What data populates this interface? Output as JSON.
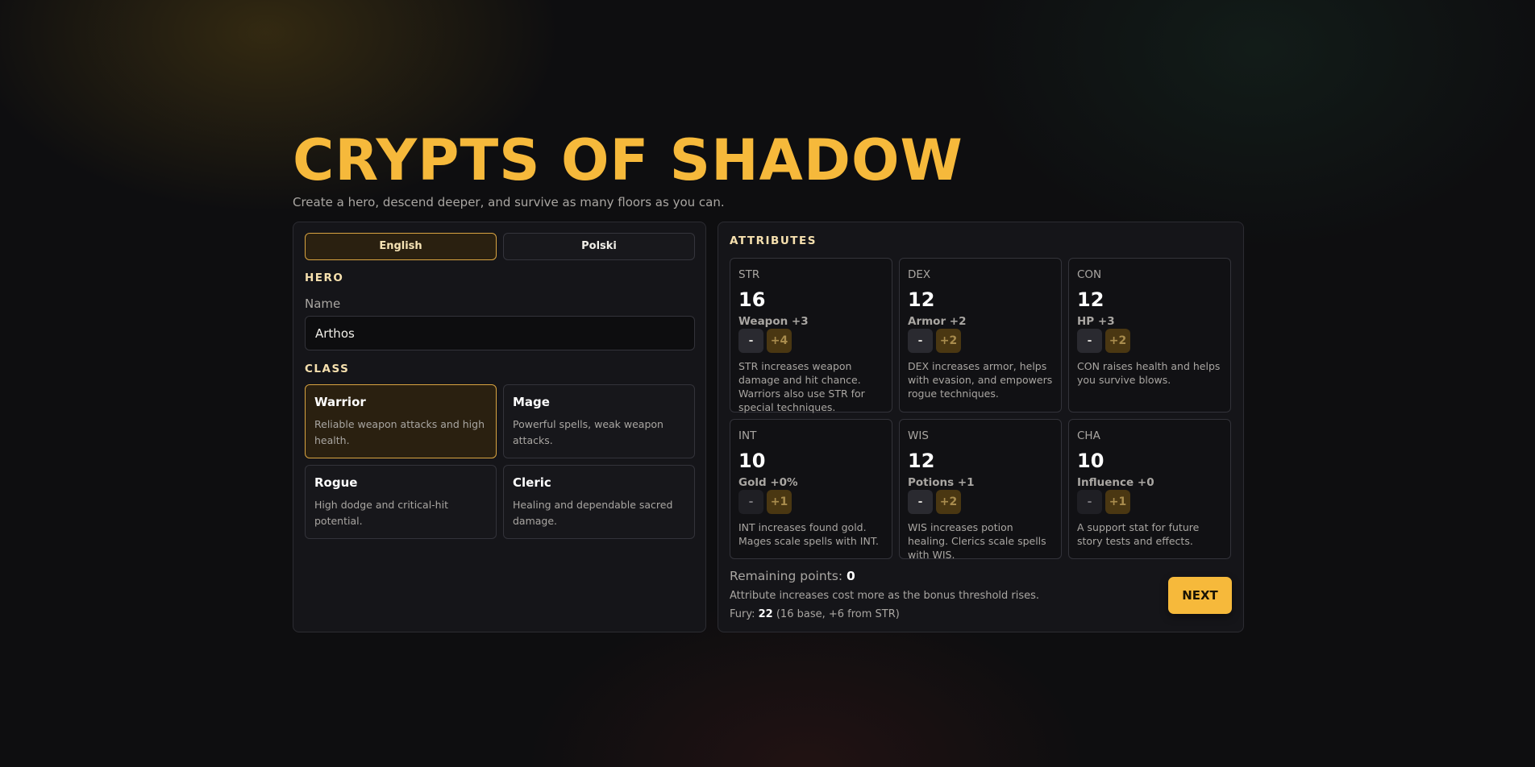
{
  "header": {
    "title": "CRYPTS OF SHADOW",
    "subtitle": "Create a hero, descend deeper, and survive as many floors as you can."
  },
  "languages": {
    "english": "English",
    "polski": "Polski",
    "active": "English"
  },
  "hero": {
    "section_label": "HERO",
    "name_label": "Name",
    "name_value": "Arthos"
  },
  "class_section": {
    "label": "CLASS",
    "selected": "Warrior",
    "classes": [
      {
        "name": "Warrior",
        "desc": "Reliable weapon attacks and high health."
      },
      {
        "name": "Mage",
        "desc": "Powerful spells, weak weapon attacks."
      },
      {
        "name": "Rogue",
        "desc": "High dodge and critical-hit potential."
      },
      {
        "name": "Cleric",
        "desc": "Healing and dependable sacred damage."
      }
    ]
  },
  "attributes": {
    "label": "ATTRIBUTES",
    "items": [
      {
        "code": "STR",
        "value": "16",
        "bonus": "Weapon +3",
        "minus": "-",
        "plus": "+4",
        "desc": "STR increases weapon damage and hit chance. Warriors also use STR for special techniques."
      },
      {
        "code": "DEX",
        "value": "12",
        "bonus": "Armor +2",
        "minus": "-",
        "plus": "+2",
        "desc": "DEX increases armor, helps with evasion, and empowers rogue techniques."
      },
      {
        "code": "CON",
        "value": "12",
        "bonus": "HP +3",
        "minus": "-",
        "plus": "+2",
        "desc": "CON raises health and helps you survive blows."
      },
      {
        "code": "INT",
        "value": "10",
        "bonus": "Gold +0%",
        "minus": "-",
        "plus": "+1",
        "desc": "INT increases found gold. Mages scale spells with INT."
      },
      {
        "code": "WIS",
        "value": "12",
        "bonus": "Potions +1",
        "minus": "-",
        "plus": "+2",
        "desc": "WIS increases potion healing. Clerics scale spells with WIS."
      },
      {
        "code": "CHA",
        "value": "10",
        "bonus": "Influence +0",
        "minus": "-",
        "plus": "+1",
        "desc": "A support stat for future story tests and effects."
      }
    ]
  },
  "footer": {
    "remaining_label": "Remaining points:",
    "remaining_value": "0",
    "rule_note": "Attribute increases cost more as the bonus threshold rises.",
    "fury_label": "Fury:",
    "fury_value": "22",
    "fury_detail": "(16 base, +6 from STR)",
    "next_label": "NEXT"
  },
  "colors": {
    "accent": "#f6b93b",
    "selected_border": "#d9a441",
    "background": "#0e0e10"
  }
}
